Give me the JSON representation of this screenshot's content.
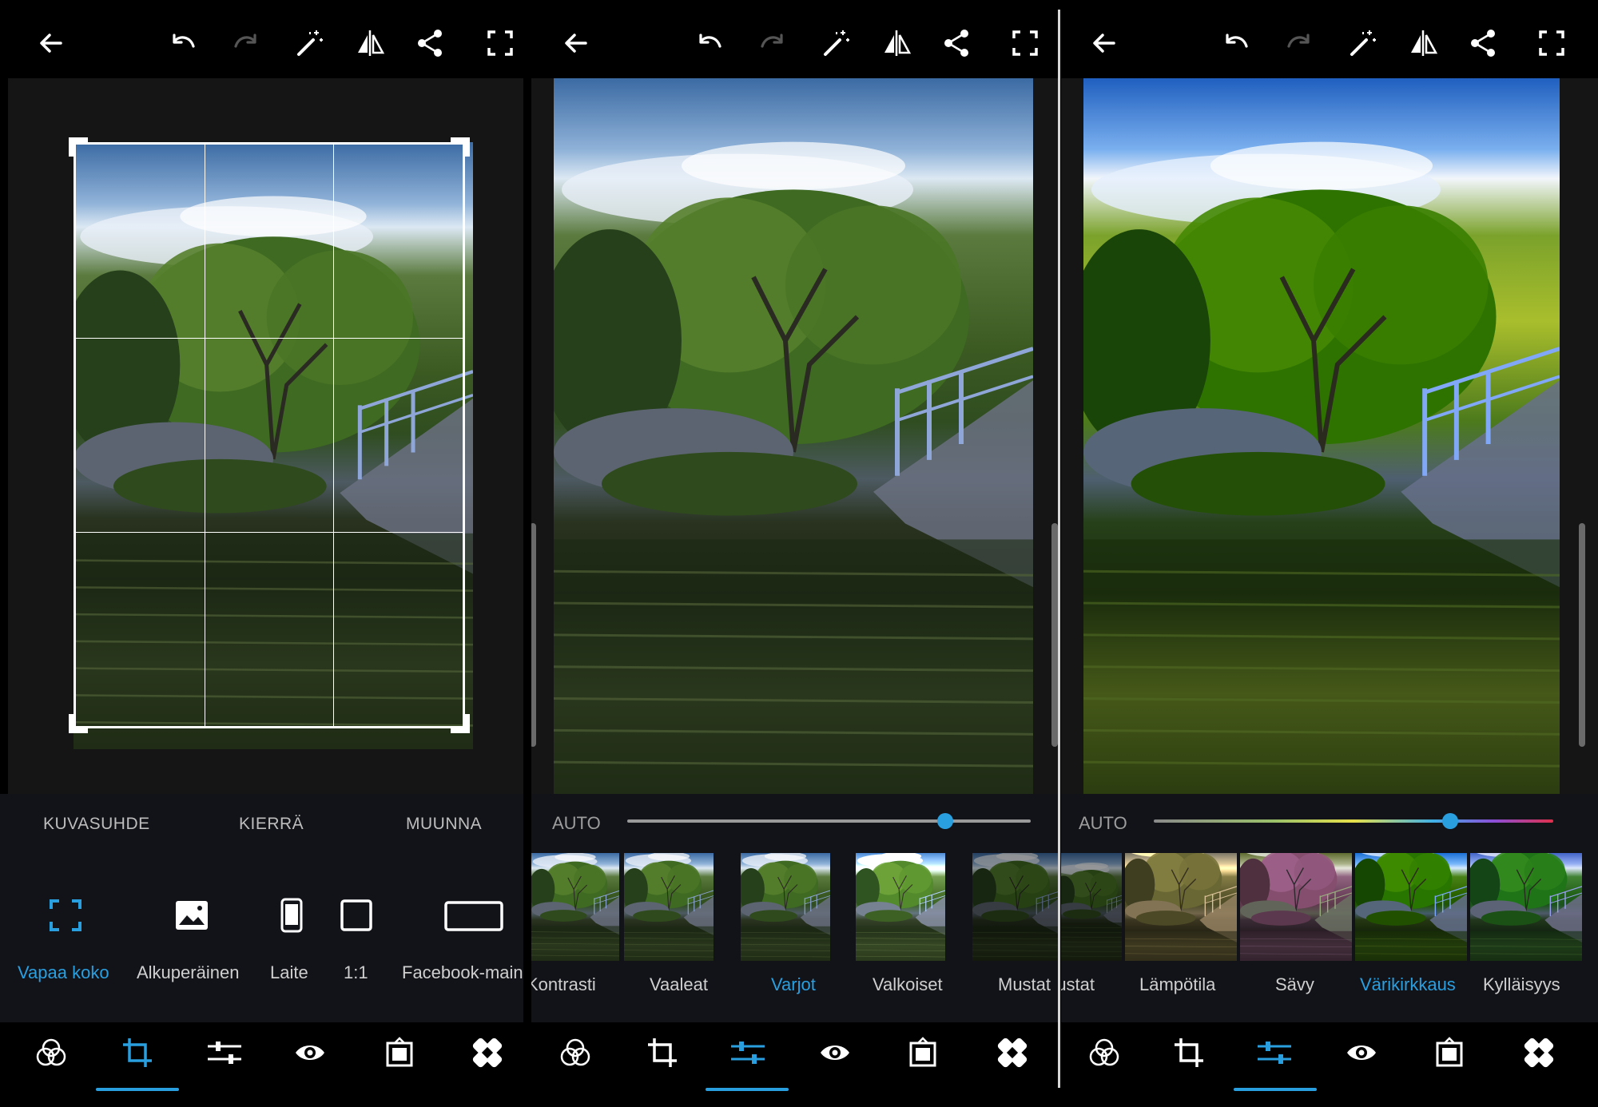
{
  "colors": {
    "accent": "#2a9fe0",
    "background": "#000000",
    "panel_bg": "#121318",
    "workspace_bg": "#151515"
  },
  "icons": [
    "back-arrow-icon",
    "undo-icon",
    "redo-icon",
    "magic-wand-icon",
    "compare-icon",
    "share-icon",
    "fullscreen-icon"
  ],
  "panels": [
    {
      "crop_tabs": [
        {
          "label": "KUVASUHDE",
          "active": true
        },
        {
          "label": "KIERRÄ",
          "active": false
        },
        {
          "label": "MUUNNA",
          "active": false
        }
      ],
      "ratios": [
        {
          "label": "Vapaa koko",
          "icon": "free-crop-icon",
          "active": true
        },
        {
          "label": "Alkuperäinen",
          "icon": "image-icon",
          "active": false
        },
        {
          "label": "Laite",
          "icon": "phone-icon",
          "active": false
        },
        {
          "label": "1:1",
          "icon": "square-icon",
          "active": false
        },
        {
          "label": "Facebook-main",
          "icon": "wide-rect-icon",
          "active": false
        }
      ],
      "active_nav": "crop"
    },
    {
      "auto_label": "AUTO",
      "slider_value": 0.8,
      "thumbs": [
        {
          "label": "Kontrasti",
          "active": false
        },
        {
          "label": "Vaaleat",
          "active": false
        },
        {
          "label": "Varjot",
          "active": true
        },
        {
          "label": "Valkoiset",
          "active": false
        },
        {
          "label": "Mustat",
          "active": false
        }
      ],
      "active_nav": "adjust"
    },
    {
      "auto_label": "AUTO",
      "slider_value": 0.74,
      "thumbs": [
        {
          "label": "Mustat",
          "active": false
        },
        {
          "label": "Lämpötila",
          "active": false
        },
        {
          "label": "Sävy",
          "active": false
        },
        {
          "label": "Värikirkkaus",
          "active": true
        },
        {
          "label": "Kylläisyys",
          "active": false
        }
      ],
      "active_nav": "adjust"
    }
  ],
  "nav_items": [
    {
      "id": "looks",
      "icon": "looks-circles-icon"
    },
    {
      "id": "crop",
      "icon": "crop-icon"
    },
    {
      "id": "adjust",
      "icon": "sliders-icon"
    },
    {
      "id": "redeye",
      "icon": "eye-icon"
    },
    {
      "id": "frames",
      "icon": "frame-icon"
    },
    {
      "id": "heal",
      "icon": "bandage-icon"
    }
  ]
}
